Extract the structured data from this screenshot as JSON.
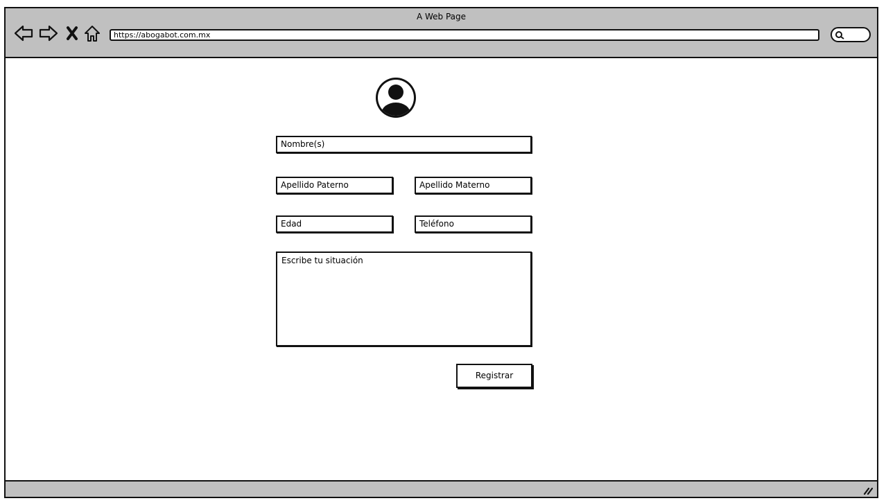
{
  "window": {
    "title": "A Web Page",
    "url": "https://abogabot.com.mx"
  },
  "nav": {
    "icons": [
      "back-arrow-icon",
      "forward-arrow-icon",
      "close-icon",
      "home-icon",
      "search-icon"
    ]
  },
  "form": {
    "nombre": "Nombre(s)",
    "apellido_paterno": "Apellido Paterno",
    "apellido_materno": "Apellido Materno",
    "edad": "Edad",
    "telefono": "Teléfono",
    "situacion": "Escribe tu situación",
    "submit_label": "Registrar"
  },
  "colors": {
    "chrome_gray": "#c0c0c0",
    "outline": "#111111",
    "background": "#ffffff"
  }
}
